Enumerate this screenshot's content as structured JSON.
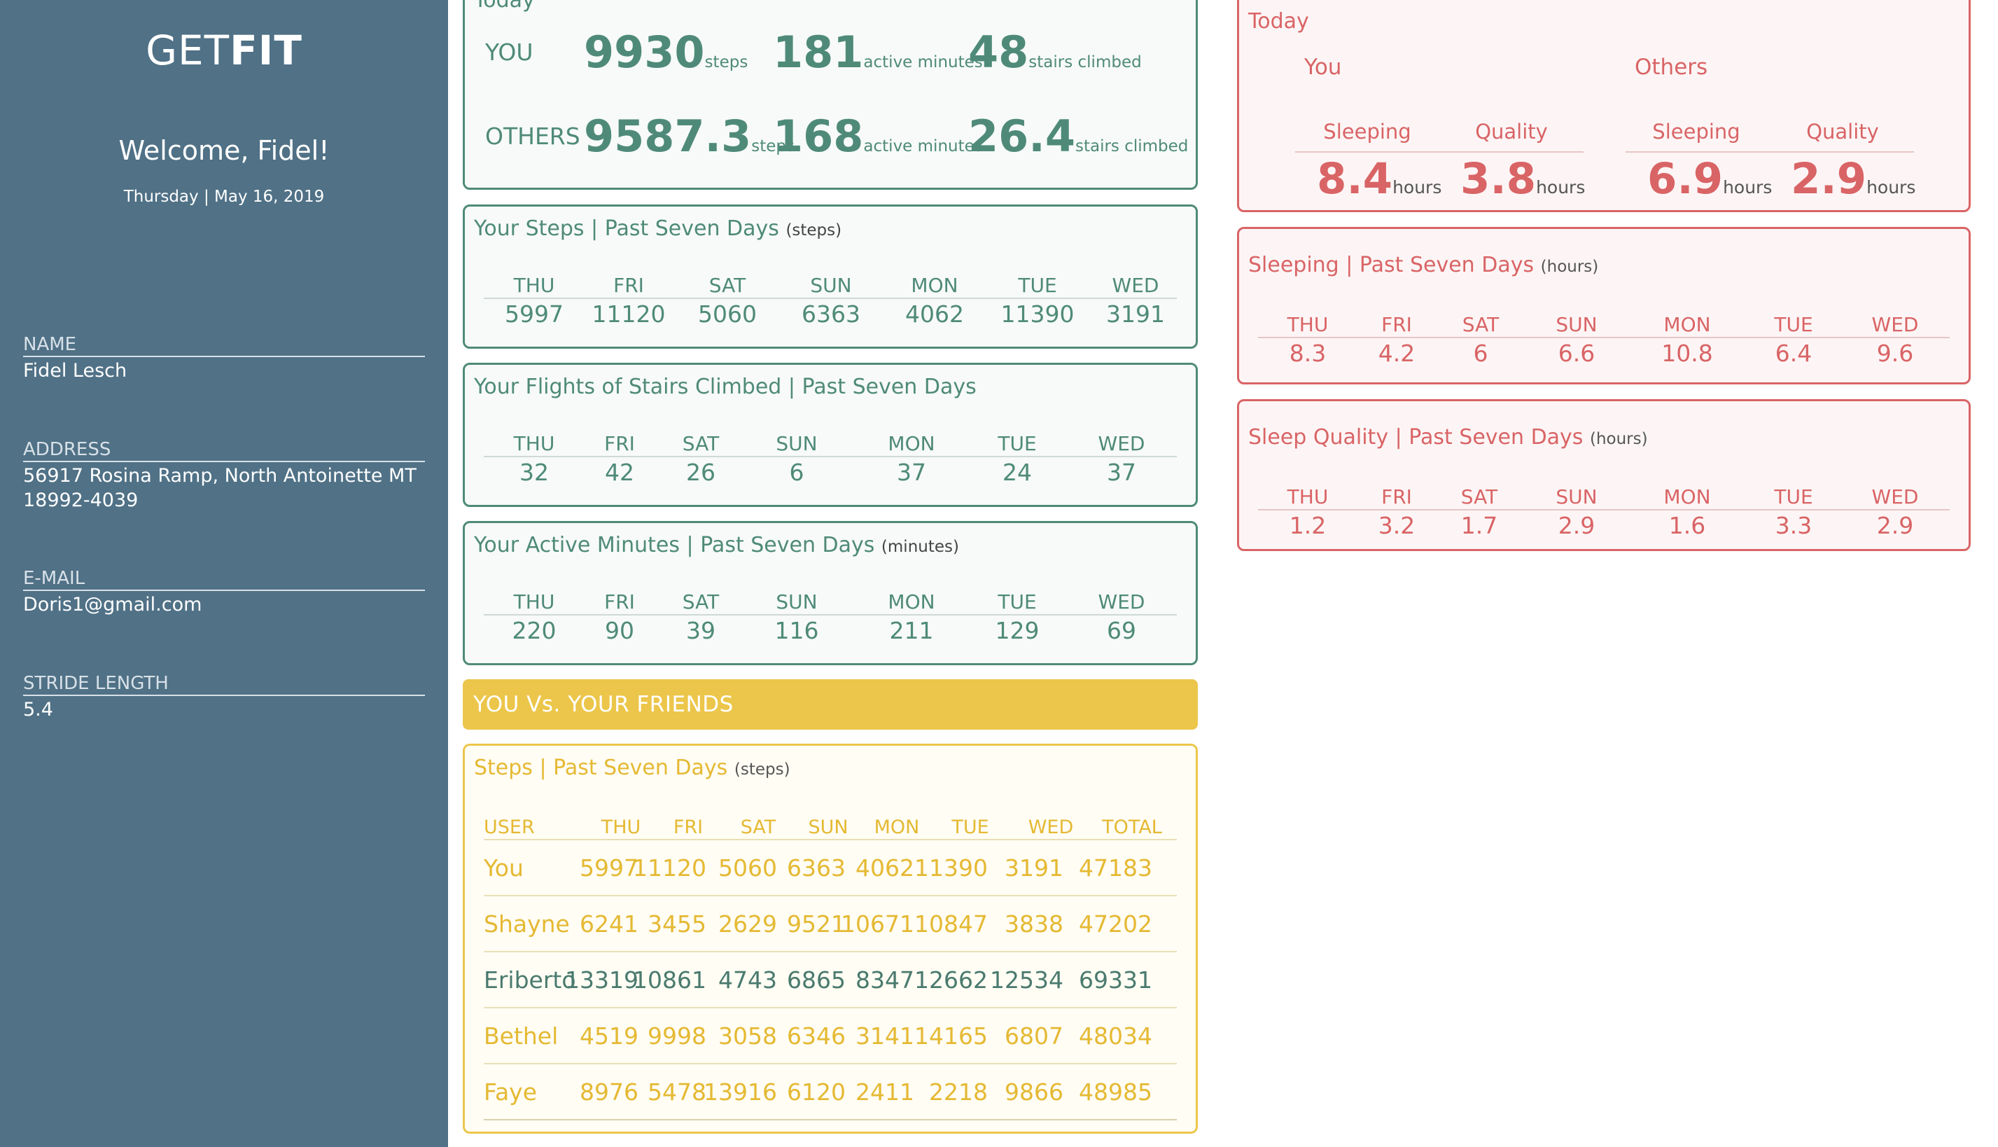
{
  "sidebar": {
    "logo_light": "GET",
    "logo_bold": "FIT",
    "welcome": "Welcome, Fidel!",
    "date": "Thursday | May 16, 2019",
    "fields": [
      {
        "label": "NAME",
        "value": "Fidel Lesch",
        "value2": ""
      },
      {
        "label": "ADDRESS",
        "value": "56917 Rosina Ramp, North Antoinette MT",
        "value2": "18992-4039"
      },
      {
        "label": "E-MAIL",
        "value": "Doris1@gmail.com",
        "value2": ""
      },
      {
        "label": "STRIDE LENGTH",
        "value": "5.4",
        "value2": ""
      }
    ]
  },
  "today": {
    "title": "Today",
    "you_label": "YOU",
    "others_label": "OTHERS",
    "you": {
      "steps": "9930",
      "active": "181",
      "stairs": "48"
    },
    "others": {
      "steps": "9587.3",
      "active": "168",
      "stairs": "26.4"
    },
    "units": {
      "steps": "steps",
      "active": "active minutes",
      "stairs": "stairs climbed"
    }
  },
  "days": [
    "THU",
    "FRI",
    "SAT",
    "SUN",
    "MON",
    "TUE",
    "WED"
  ],
  "steps_week": {
    "title": "Your Steps | Past Seven Days",
    "unit": "(steps)",
    "values": [
      "5997",
      "11120",
      "5060",
      "6363",
      "4062",
      "11390",
      "3191"
    ]
  },
  "stairs_week": {
    "title": "Your Flights of Stairs Climbed | Past Seven Days",
    "values": [
      "32",
      "42",
      "26",
      "6",
      "37",
      "24",
      "37"
    ]
  },
  "active_week": {
    "title": "Your Active Minutes | Past Seven Days",
    "unit": "(minutes)",
    "values": [
      "220",
      "90",
      "39",
      "116",
      "211",
      "129",
      "69"
    ]
  },
  "friends": {
    "banner": "YOU Vs. YOUR FRIENDS",
    "title": "Steps | Past Seven Days",
    "unit": "(steps)",
    "headers": [
      "USER",
      "THU",
      "FRI",
      "SAT",
      "SUN",
      "MON",
      "TUE",
      "WED",
      "TOTAL"
    ],
    "rows": [
      {
        "user": "You",
        "values": [
          "5997",
          "11120",
          "5060",
          "6363",
          "4062",
          "11390",
          "3191"
        ],
        "total": "47183",
        "highlight": false
      },
      {
        "user": "Shayne",
        "values": [
          "6241",
          "3455",
          "2629",
          "9521",
          "10671",
          "10847",
          "3838"
        ],
        "total": "47202",
        "highlight": false
      },
      {
        "user": "Eriberto",
        "values": [
          "13319",
          "10861",
          "4743",
          "6865",
          "8347",
          "12662",
          "12534"
        ],
        "total": "69331",
        "highlight": true
      },
      {
        "user": "Bethel",
        "values": [
          "4519",
          "9998",
          "3058",
          "6346",
          "3141",
          "14165",
          "6807"
        ],
        "total": "48034",
        "highlight": false
      },
      {
        "user": "Faye",
        "values": [
          "8976",
          "5478",
          "13916",
          "6120",
          "2411",
          "2218",
          "9866"
        ],
        "total": "48985",
        "highlight": false
      }
    ]
  },
  "sleep_today": {
    "title": "Today",
    "you_label": "You",
    "others_label": "Others",
    "sleeping_label": "Sleeping",
    "quality_label": "Quality",
    "you": {
      "sleeping": "8.4",
      "quality": "3.8"
    },
    "others": {
      "sleeping": "6.9",
      "quality": "2.9"
    },
    "unit": "hours"
  },
  "sleep_week": {
    "title": "Sleeping | Past Seven Days",
    "unit": "(hours)",
    "values": [
      "8.3",
      "4.2",
      "6",
      "6.6",
      "10.8",
      "6.4",
      "9.6"
    ]
  },
  "quality_week": {
    "title": "Sleep Quality | Past Seven Days",
    "unit": "(hours)",
    "values": [
      "1.2",
      "3.2",
      "1.7",
      "2.9",
      "1.6",
      "3.3",
      "2.9"
    ]
  },
  "colors": {
    "sidebar": "#507186",
    "green": "#4f8a79",
    "red": "#d96466",
    "yellow": "#ecc64a"
  }
}
